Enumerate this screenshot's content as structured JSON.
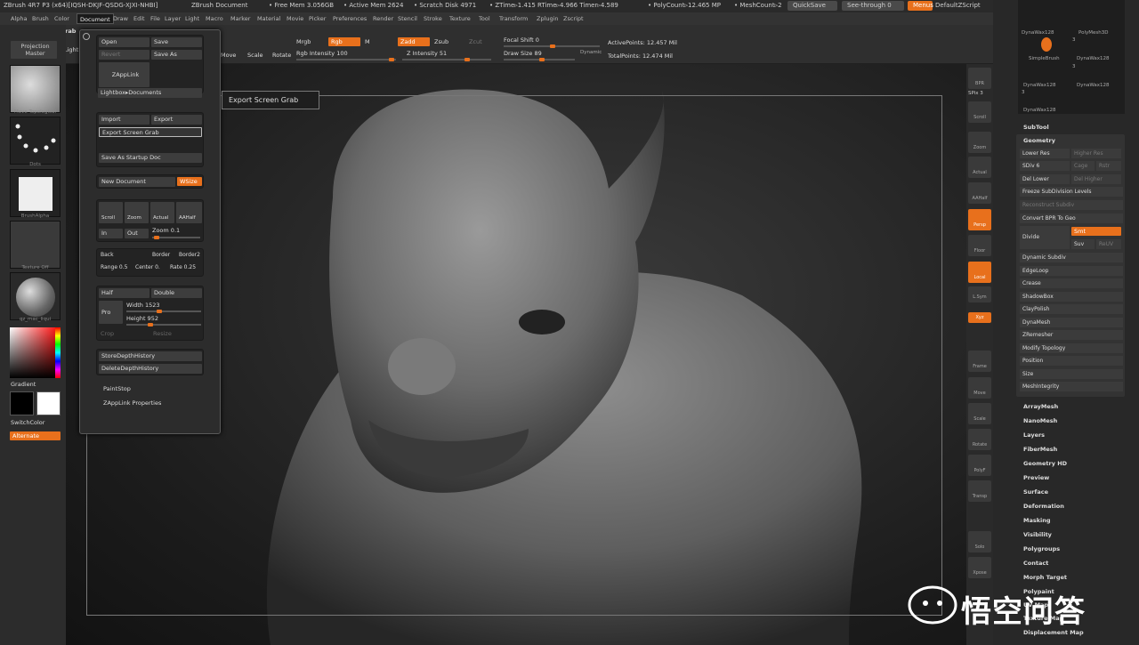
{
  "title_bar": {
    "app_title": "ZBrush 4R7 P3 (x64)[IQSH-DKJF-QSDG-XJXI-NHBI]",
    "document_name": "ZBrush Document",
    "free_mem": "• Free Mem 3.056GB",
    "active_mem": "• Active Mem 2624",
    "scratch_disk": "• Scratch Disk 4971",
    "ztime": "• ZTime▹1.415 RTime▹4.966 Timer▹4.589",
    "polycount": "• PolyCount▹12.465 MP",
    "meshcount": "• MeshCount▹2",
    "quicksave": "QuickSave",
    "see_through": "See-through  0",
    "menus": "Menus",
    "default_zscript": "DefaultZScript"
  },
  "menu_bar": {
    "items": [
      "Alpha",
      "Brush",
      "Color",
      "Document",
      "Draw",
      "Edit",
      "File",
      "Layer",
      "Light",
      "Macro",
      "Marker",
      "Material",
      "Movie",
      "Picker",
      "Preferences",
      "Render",
      "Stencil",
      "Stroke",
      "Texture",
      "Tool",
      "Transform",
      "Zplugin",
      "Zscript"
    ],
    "active": "Document"
  },
  "toolshelf": {
    "export_screen_grab": "Export Screen Grab",
    "lightbox": "LightBox",
    "move": "Move",
    "scale": "Scale",
    "rotate": "Rotate",
    "mrgb": "Mrgb",
    "rgb": "Rgb",
    "m": "M",
    "rgb_intensity": "Rgb Intensity 100",
    "zadd": "Zadd",
    "zsub": "Zsub",
    "zcut": "Zcut",
    "z_intensity": "Z Intensity 51",
    "focal_shift": "Focal Shift 0",
    "draw_size": "Draw Size 89",
    "dynamic": "Dynamic",
    "active_points": "ActivePoints: 12.457 Mil",
    "total_points": "TotalPoints: 12.474 Mil"
  },
  "left_panel": {
    "projection_master": "Projection Master",
    "brush_labels": [
      "Move Topological",
      "Dots",
      "BrushAlpha",
      "Texture Off",
      "qz_mac_liqui"
    ],
    "gradient": "Gradient",
    "switch_color": "SwitchColor",
    "alternate": "Alternate",
    "accent": "#e8701c"
  },
  "document_menu": {
    "open": "Open",
    "save": "Save",
    "revert": "Revert",
    "save_as": "Save As",
    "zapplink": "ZAppLink",
    "lightbox_documents": "Lightbox▸Documents",
    "import": "Import",
    "export": "Export",
    "export_screen_grab": "Export Screen Grab",
    "save_as_startup_doc": "Save As Startup Doc",
    "new_document": "New Document",
    "wsize": "WSize",
    "scroll": "Scroll",
    "zoom": "Zoom",
    "actual": "Actual",
    "aahalf": "AAHalf",
    "in": "In",
    "out": "Out",
    "zoom_value": "Zoom 0.1",
    "back": "Back",
    "border": "Border",
    "border2": "Border2",
    "range": "Range 0.5",
    "center": "Center 0.",
    "rate": "Rate 0.25",
    "half": "Half",
    "double": "Double",
    "pro": "Pro",
    "width": "Width 1523",
    "height": "Height 952",
    "crop": "Crop",
    "resize": "Resize",
    "store_depth_history": "StoreDepthHistory",
    "delete_depth_history": "DeleteDepthHistory",
    "paintstop": "PaintStop",
    "zapplink_properties": "ZAppLink Properties"
  },
  "tooltip": "Export Screen Grab",
  "right_tools": [
    "BPR",
    "Scroll",
    "Zoom",
    "Actual",
    "AAHalf",
    "Persp",
    "Floor",
    "Local",
    "L.Sym",
    "Xyz",
    "Frame",
    "Move",
    "Scale",
    "Rotate",
    "PolyF",
    "Transp",
    "Solo",
    "Xpose"
  ],
  "spix": "SPix 3",
  "tool_palette": {
    "brushes": [
      "DynaWax128",
      "SimpleBrush",
      "PolyMesh3D",
      "DynaWax128",
      "DynaWax128",
      "DynaWax128",
      "DynaWax128"
    ],
    "counts": [
      "3",
      "3",
      "3"
    ],
    "subtool": "SubTool",
    "geometry": "Geometry",
    "lower_res": "Lower Res",
    "higher_res": "Higher Res",
    "sdiv": "SDiv 6",
    "cage": "Cage",
    "rstr": "Rstr",
    "del_lower": "Del Lower",
    "del_higher": "Del Higher",
    "freeze": "Freeze SubDivision Levels",
    "reconstruct": "Reconstruct Subdiv",
    "convert_bpr": "Convert BPR To Geo",
    "divide": "Divide",
    "smt": "Smt",
    "suv": "Suv",
    "reuv": "ReUV",
    "geo_items": [
      "Dynamic Subdiv",
      "EdgeLoop",
      "Crease",
      "ShadowBox",
      "ClayPolish",
      "DynaMesh",
      "ZRemesher",
      "Modify Topology",
      "Position",
      "Size",
      "MeshIntegrity"
    ],
    "sub_items": [
      "ArrayMesh",
      "NanoMesh",
      "Layers",
      "FiberMesh",
      "Geometry HD",
      "Preview",
      "Surface",
      "Deformation",
      "Masking",
      "Visibility",
      "Polygroups",
      "Contact",
      "Morph Target",
      "Polypaint",
      "UV Map",
      "Texture Map",
      "Displacement Map"
    ]
  },
  "watermark": "悟空问答"
}
